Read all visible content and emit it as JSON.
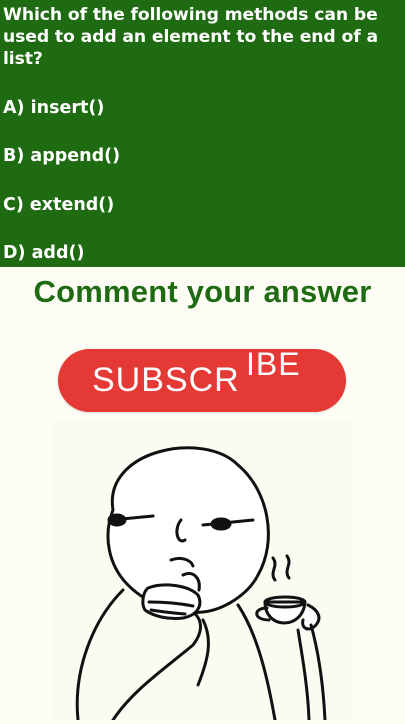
{
  "quiz": {
    "question": "Which of the following methods can be used to add an element to the end of a list?",
    "options": {
      "a": "A) insert()",
      "b": "B) append()",
      "c": "C) extend()",
      "d": "D) add()"
    }
  },
  "cta": {
    "comment": "Comment your answer"
  },
  "subscribe": {
    "main": "SUBSCR",
    "tail": "IBE"
  },
  "colors": {
    "panel_green": "#1f6b12",
    "cta_green": "#1f6b12",
    "subscribe_red": "#e53935"
  },
  "sticker": {
    "icon": "thinking-meme-face-with-tea-icon"
  }
}
